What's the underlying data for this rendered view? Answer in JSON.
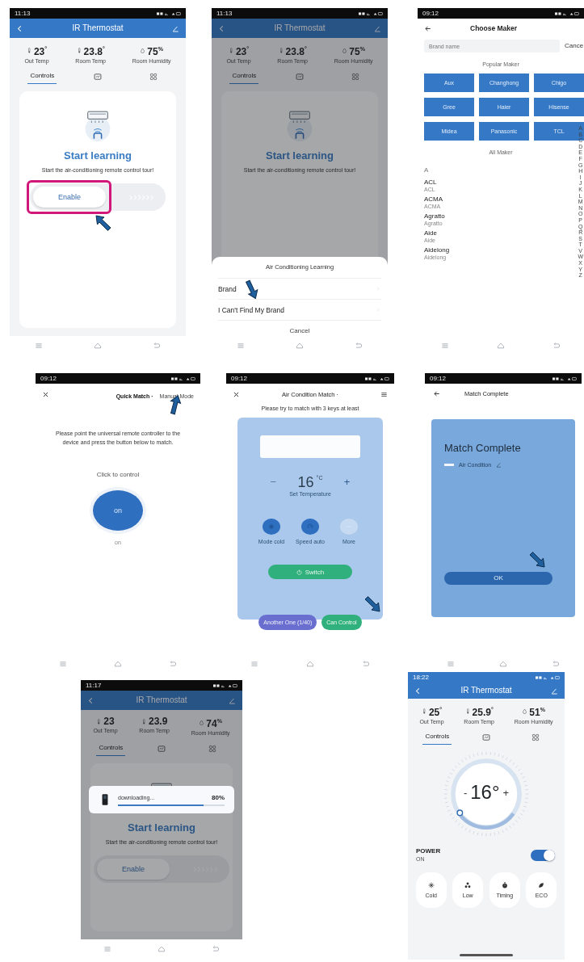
{
  "screens": [
    {
      "kind": "learn",
      "time": "11:13",
      "title": "IR Thermostat",
      "dimmed": false,
      "stats": [
        {
          "value": "23$^{°}$",
          "label": "Out Temp"
        },
        {
          "value": "23.8$^{°}$",
          "label": "Room Temp"
        },
        {
          "value": "75$^{%}$",
          "label": "Room Humidity"
        }
      ],
      "tabs": [
        {
          "label": "Controls",
          "selected": true
        },
        {
          "selected": false
        },
        {
          "selected": false
        }
      ],
      "heading": "Start learning",
      "description": "Start the air-conditioning remote control tour!",
      "button": "Enable",
      "highlighted": true,
      "pointer": true
    },
    {
      "kind": "learn",
      "time": "11:13",
      "title": "IR Thermostat",
      "dimmed": true,
      "stats": [
        {
          "value": "23$^{°}$",
          "label": "Out Temp"
        },
        {
          "value": "23.8$^{°}$",
          "label": "Room Temp"
        },
        {
          "value": "75$^{%}$",
          "label": "Room Humidity"
        }
      ],
      "tabs": [
        {
          "label": "Controls",
          "selected": true
        },
        {
          "selected": false
        },
        {
          "selected": false
        }
      ],
      "heading": "Start learning",
      "description": "Start the air-conditioning remote control tour!",
      "sheet": {
        "title": "Air Conditioning Learning",
        "options": [
          {
            "label": "Brand",
            "pointer": true
          },
          {
            "label": "I Can't Find My Brand"
          }
        ],
        "cancel": "Cancel"
      }
    },
    {
      "kind": "maker",
      "time": "09:12",
      "title": "Choose Maker",
      "placeholder": "Brand name",
      "cancel": "Cance",
      "popular_label": "Popular Maker",
      "popular": [
        "Aux",
        "Changhong",
        "Chigo",
        "Gree",
        "Haier",
        "Hisense",
        "Midea",
        "Panasonic",
        "TCL"
      ],
      "all_label": "All Maker",
      "section": "A",
      "makers": [
        {
          "name": "ACL",
          "sub": "ACL"
        },
        {
          "name": "ACMA",
          "sub": "ACMA"
        },
        {
          "name": "Agratto",
          "sub": "Agratto"
        },
        {
          "name": "Aide",
          "sub": "Aide"
        },
        {
          "name": "Aidelong",
          "sub": "Aidelong"
        }
      ],
      "index": [
        "A",
        "B",
        "C",
        "D",
        "E",
        "F",
        "G",
        "H",
        "I",
        "J",
        "K",
        "L",
        "M",
        "N",
        "O",
        "P",
        "Q",
        "R",
        "S",
        "T",
        "V",
        "W",
        "X",
        "Y",
        "Z"
      ]
    },
    {
      "kind": "quick_match",
      "time": "09:12",
      "tabs": [
        {
          "label": "Quick Match ·",
          "selected": true
        },
        {
          "label": "Manual Mode",
          "selected": false,
          "pointer": true
        }
      ],
      "instructions": "Please point the universal remote controller to the device and press the button below to match.",
      "prompt": "Click to control",
      "button": "on",
      "caption": "on"
    },
    {
      "kind": "ac_match",
      "time": "09:12",
      "title": "Air Condition Match ·",
      "hint": "Please try to match with 3 keys at least",
      "temperature": "16",
      "unit": "°C",
      "temp_label": "Set Temperature",
      "minus": "−",
      "plus": "+",
      "keys": [
        {
          "label": "Mode cold",
          "on": true
        },
        {
          "label": "Speed auto",
          "on": true
        },
        {
          "label": "More",
          "on": false
        }
      ],
      "switch": "Switch",
      "buttons": [
        {
          "label": "Another One (1/40)",
          "kind": "secondary"
        },
        {
          "label": "Can Control",
          "kind": "primary",
          "pointer": true
        }
      ]
    },
    {
      "kind": "match_complete",
      "time": "09:12",
      "title": "Match Complete",
      "heading": "Match Complete",
      "device": "Air Condition",
      "button": "OK",
      "pointer": true
    },
    {
      "kind": "learn",
      "time": "11:17",
      "title": "IR Thermostat",
      "dimmed": true,
      "stats": [
        {
          "value": "23",
          "label": "Out Temp"
        },
        {
          "value": "23.9",
          "label": "Room Temp"
        },
        {
          "value": "74$^{%}$",
          "label": "Room Humidity"
        }
      ],
      "tabs": [
        {
          "label": "Controls",
          "selected": true
        },
        {
          "selected": false
        },
        {
          "selected": false
        }
      ],
      "heading": "Start learning",
      "description": "Start the air-conditioning remote control tour!",
      "button": "Enable",
      "download": {
        "label": "downloading...",
        "percent": "80%",
        "level": 0.8
      }
    },
    {
      "kind": "dial",
      "time": "18:22",
      "title": "IR Thermostat",
      "stats": [
        {
          "value": "25$^{°}$",
          "label": "Out Temp"
        },
        {
          "value": "25.9$^{°}$",
          "label": "Room Temp"
        },
        {
          "value": "51$^{%}$",
          "label": "Room Humidity"
        }
      ],
      "tabs": [
        {
          "label": "Controls",
          "selected": true
        },
        {
          "selected": false
        },
        {
          "selected": false
        }
      ],
      "minus": "-",
      "temperature": "16°",
      "plus": "+",
      "power_label": "POWER",
      "power_state": "ON",
      "power_on": true,
      "modes": [
        "Cold",
        "Low",
        "Timing",
        "ECO"
      ]
    }
  ]
}
